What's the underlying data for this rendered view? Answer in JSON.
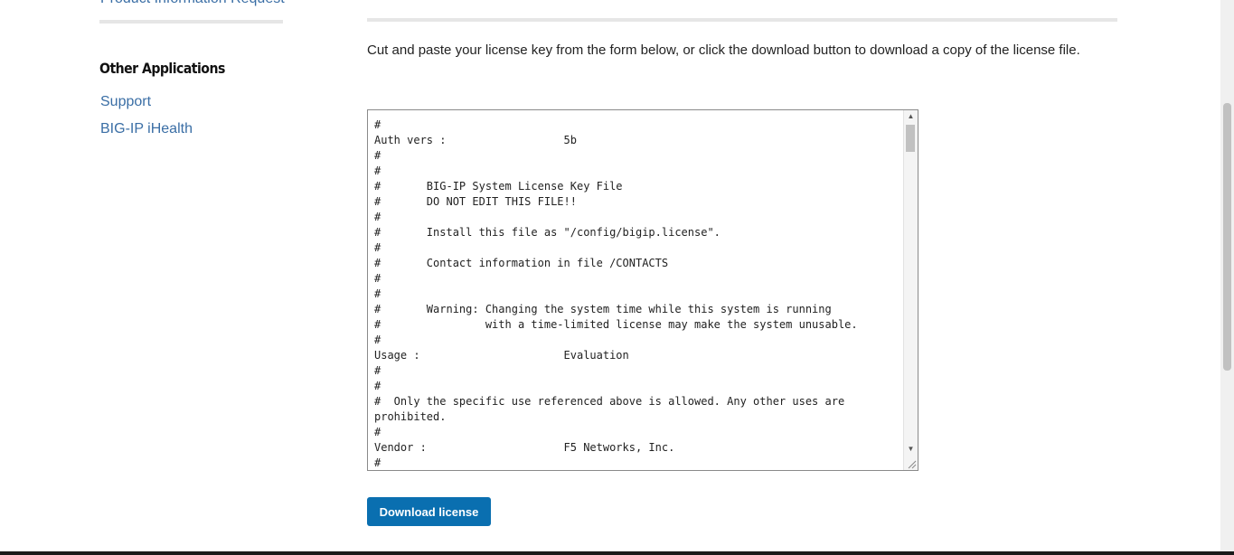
{
  "sidebar": {
    "top_link": "Product Information Request",
    "heading": "Other Applications",
    "links": [
      "Support",
      "BIG-IP iHealth"
    ]
  },
  "main": {
    "instructions": "Cut and paste your license key from the form below, or click the download button to download a copy of the license file.",
    "license_text": "#\nAuth vers :                  5b\n#\n#\n#       BIG-IP System License Key File\n#       DO NOT EDIT THIS FILE!!\n#\n#       Install this file as \"/config/bigip.license\".\n#\n#       Contact information in file /CONTACTS\n#\n#\n#       Warning: Changing the system time while this system is running\n#                with a time-limited license may make the system unusable.\n#\nUsage :                      Evaluation\n#\n#\n#  Only the specific use referenced above is allowed. Any other uses are\nprohibited.\n#\nVendor :                     F5 Networks, Inc.\n#",
    "download_label": "Download license"
  },
  "colors": {
    "link": "#3a6ea5",
    "button": "#0a6fb0",
    "divider": "#e6e6e6"
  }
}
